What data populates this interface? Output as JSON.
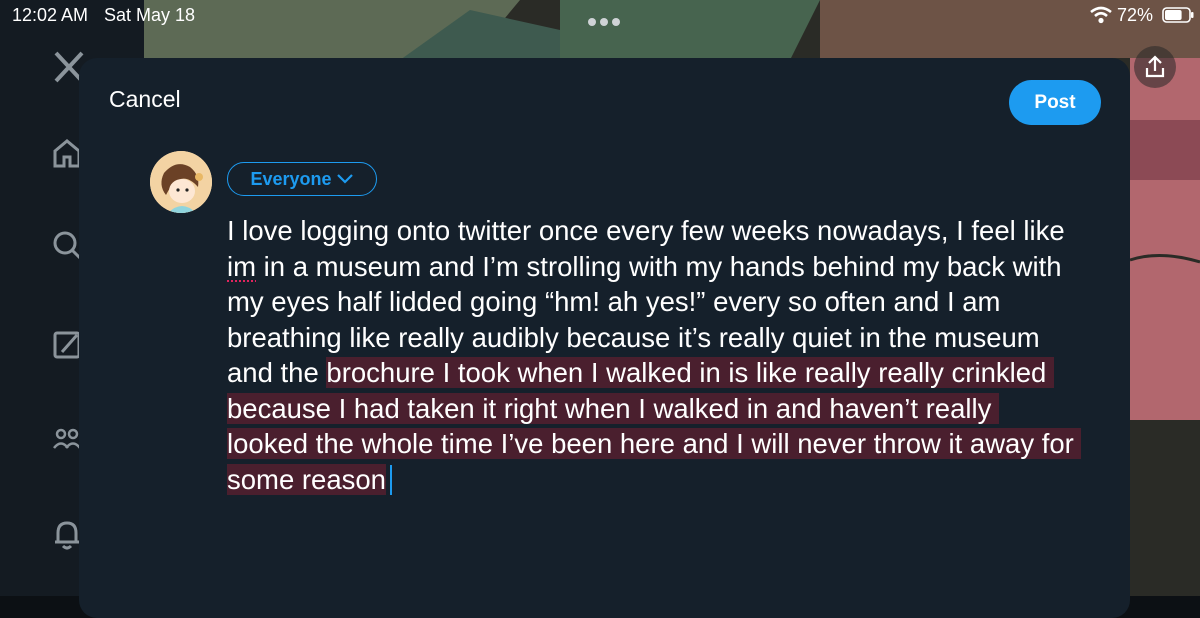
{
  "status_bar": {
    "time": "12:02 AM",
    "date": "Sat May 18",
    "battery_percent": "72%",
    "battery_level": 0.72
  },
  "sidebar": {
    "items": [
      {
        "icon": "x-logo-icon"
      },
      {
        "icon": "home-icon"
      },
      {
        "icon": "search-icon"
      },
      {
        "icon": "compose-icon"
      },
      {
        "icon": "communities-icon"
      },
      {
        "icon": "notifications-icon"
      }
    ]
  },
  "compose": {
    "cancel_label": "Cancel",
    "post_label": "Post",
    "audience_label": "Everyone",
    "text": {
      "part1": "I love logging onto twitter once every few weeks nowadays, I feel like ",
      "misspelled": "im",
      "part2": " in a museum and I’m strolling with my hands behind my back with my eyes half lidded going “hm! ah yes!” every so often and I am breathing like really audibly because it’s really quiet in the museum and the ",
      "selected": "brochure I took when I walked in is like really really crinkled because I had taken it right when I walked in and haven’t really looked the whole time I’ve been here and I will never throw it away for some reason"
    }
  },
  "colors": {
    "accent": "#1d9bf0",
    "modal_bg": "#15202b",
    "selection": "#4a1f2e",
    "spellcheck": "#e0245e"
  }
}
